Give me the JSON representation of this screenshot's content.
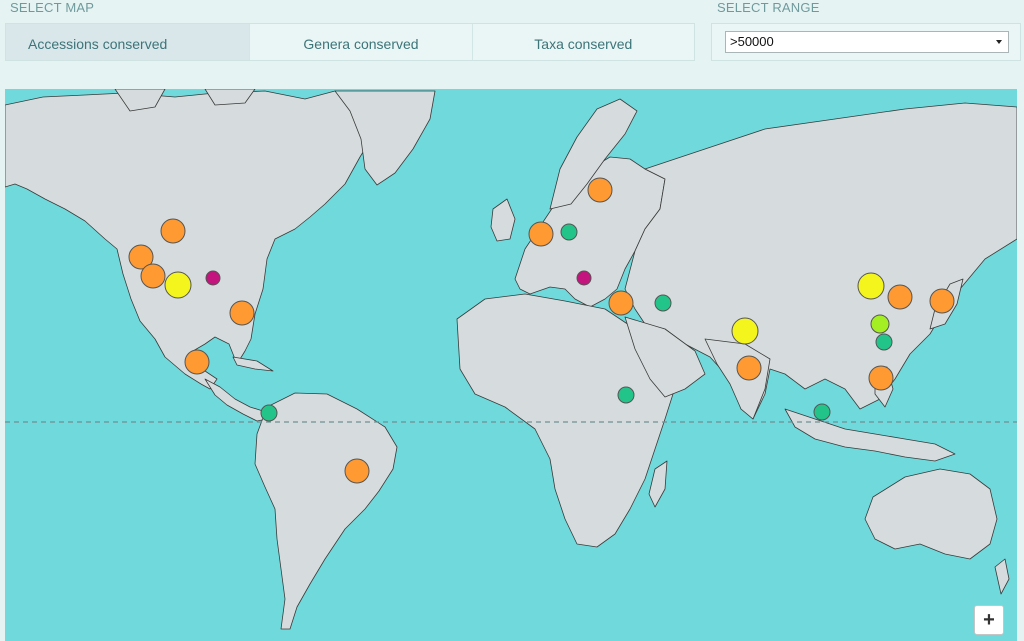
{
  "header": {
    "select_map_label": "SELECT MAP",
    "select_range_label": "SELECT RANGE"
  },
  "tabs": [
    {
      "label": "Accessions conserved",
      "active": true
    },
    {
      "label": "Genera conserved",
      "active": false
    },
    {
      "label": "Taxa conserved",
      "active": false
    }
  ],
  "range": {
    "selected": ">50000"
  },
  "map": {
    "zoom_in_label": "+",
    "ocean_color": "#6fd9db",
    "land_color": "#d6dcdd",
    "equator_shown": true,
    "marker_colors": {
      "orange": "#ff9a33",
      "yellow": "#f5f51e",
      "lime": "#a4ee24",
      "green": "#23c48a",
      "magenta": "#c4147e"
    }
  }
}
